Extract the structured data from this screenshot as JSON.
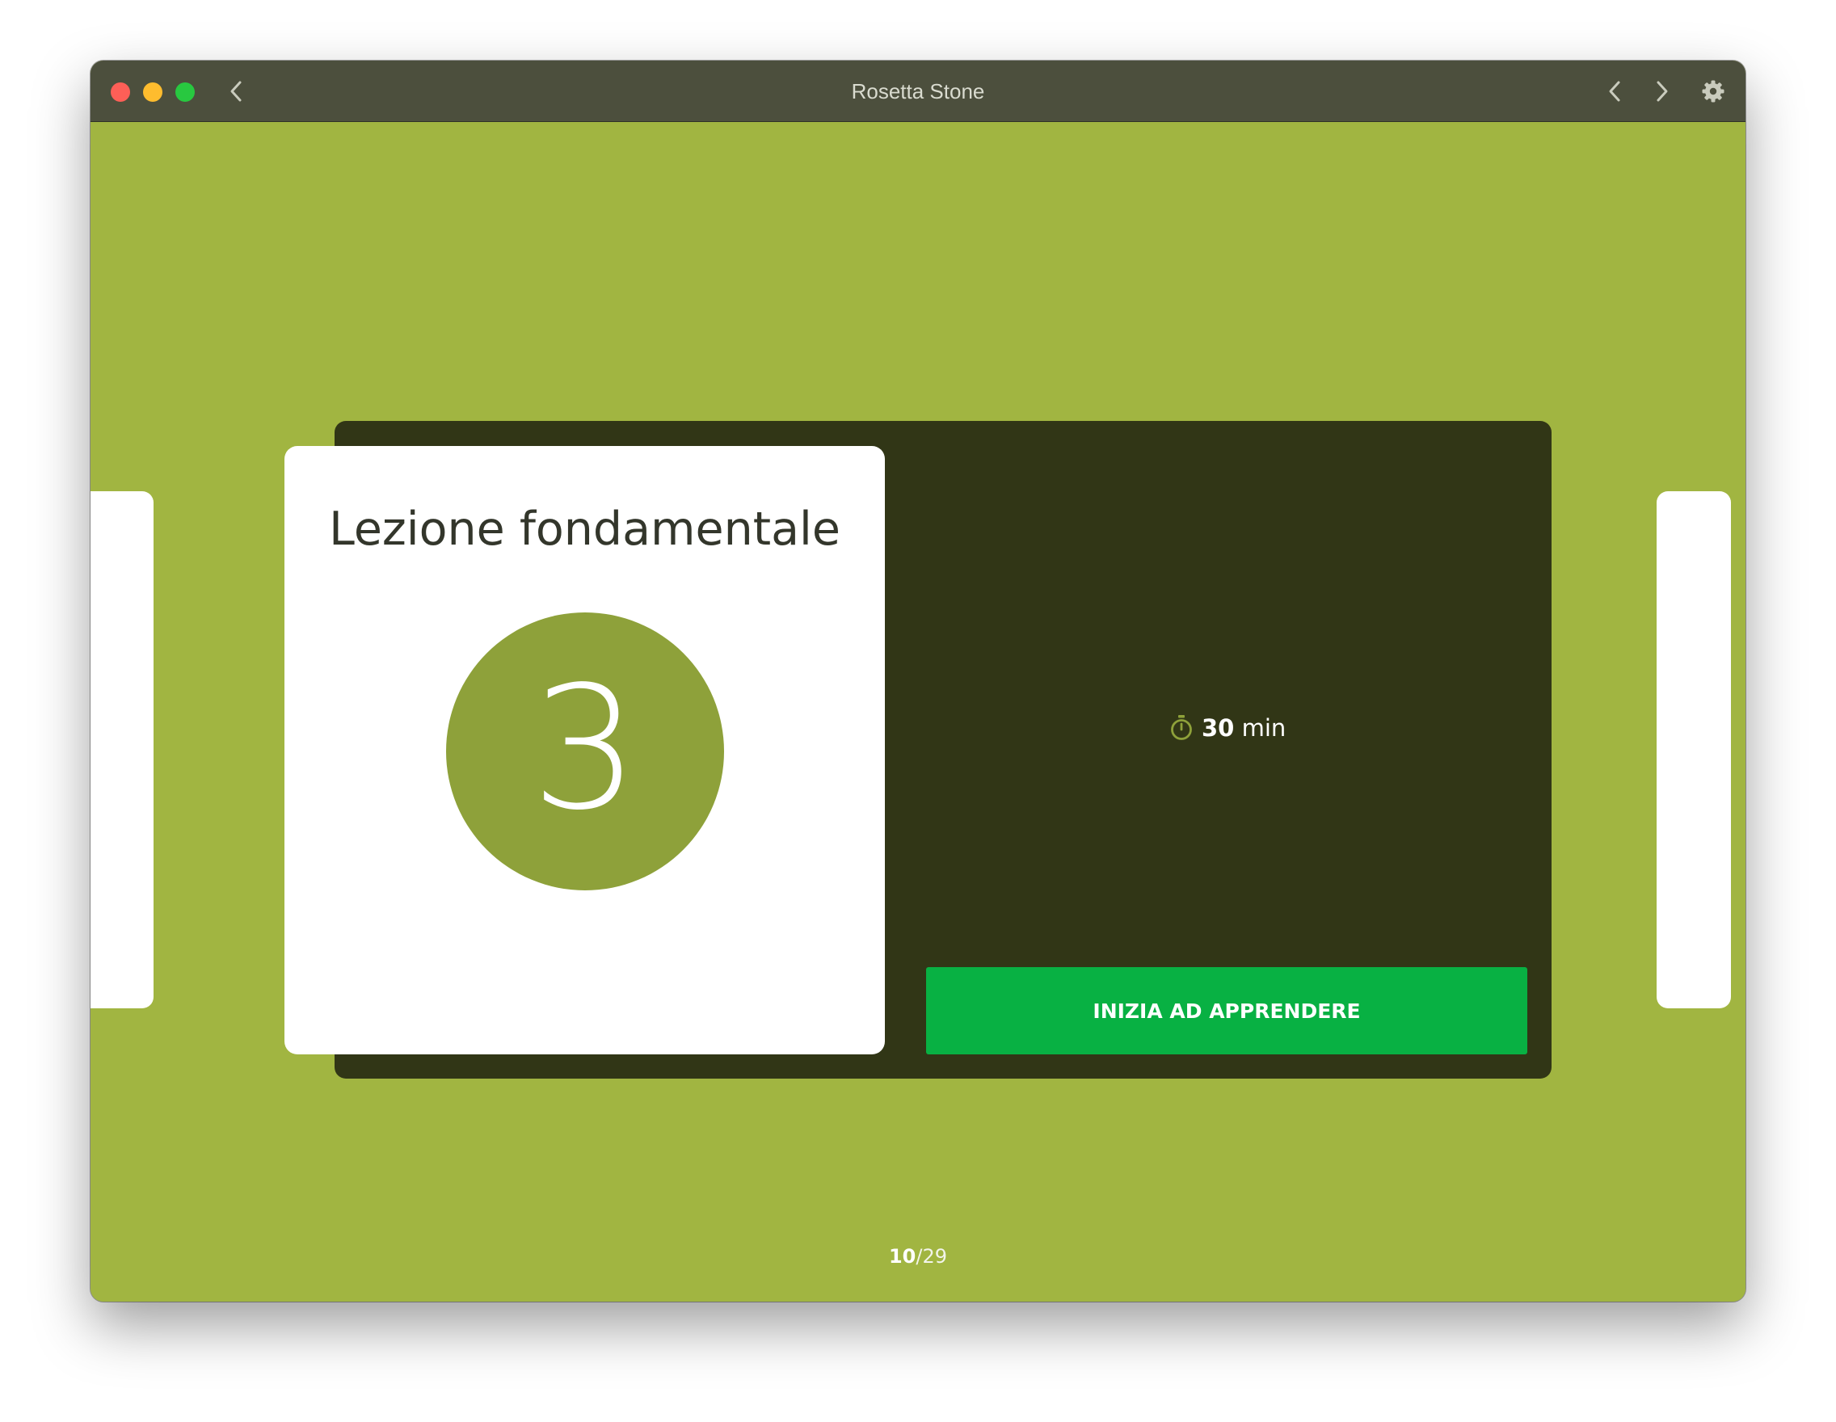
{
  "window": {
    "title": "Rosetta Stone"
  },
  "titlebar": {
    "back_icon": "chevron-left-icon",
    "prev_icon": "chevron-left-icon",
    "next_icon": "chevron-right-icon",
    "settings_icon": "gear-icon"
  },
  "lesson": {
    "title": "Lezione fondamentale",
    "number": "3",
    "duration_value": "30",
    "duration_unit": "min",
    "duration_icon": "stopwatch-icon",
    "start_label": "INIZIA AD APPRENDERE"
  },
  "pager": {
    "current": "10",
    "separator": "/",
    "total": "29"
  },
  "colors": {
    "background": "#a1b541",
    "panel": "#313616",
    "circle": "#8ea13a",
    "button": "#08b143",
    "titlebar": "#4c4f3d"
  }
}
